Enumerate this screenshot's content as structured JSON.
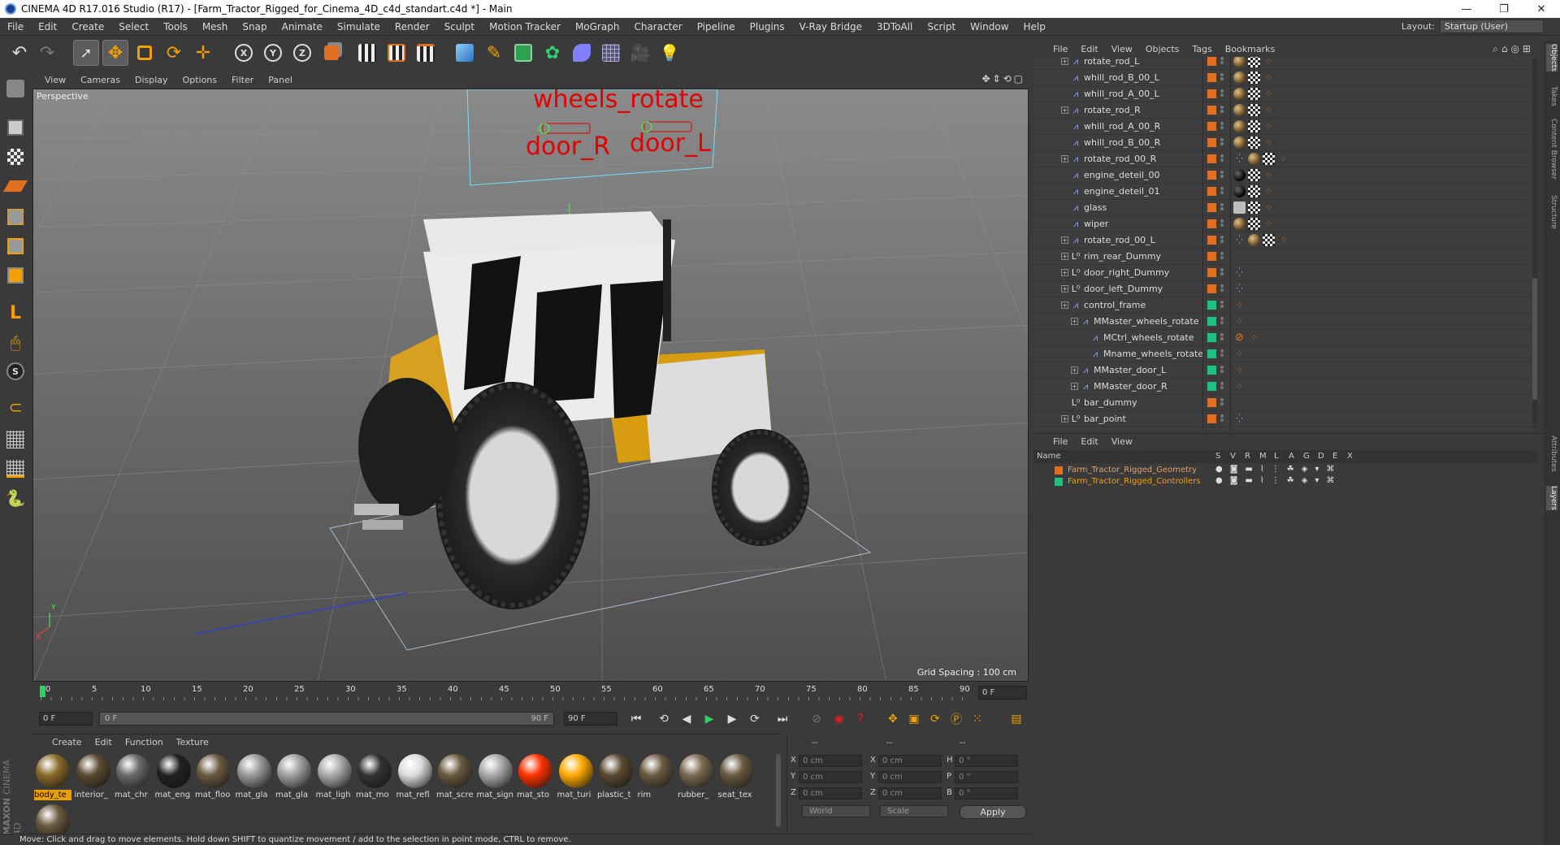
{
  "window": {
    "title": "CINEMA 4D R17.016 Studio (R17) - [Farm_Tractor_Rigged_for_Cinema_4D_c4d_standart.c4d *] - Main",
    "controls": [
      "—",
      "❐",
      "✕"
    ]
  },
  "menubar": {
    "items": [
      "File",
      "Edit",
      "Create",
      "Select",
      "Tools",
      "Mesh",
      "Snap",
      "Animate",
      "Simulate",
      "Render",
      "Sculpt",
      "Motion Tracker",
      "MoGraph",
      "Character",
      "Pipeline",
      "Plugins",
      "V-Ray Bridge",
      "3DToAll",
      "Script",
      "Window",
      "Help"
    ],
    "layout_label": "Layout:",
    "layout_value": "Startup (User)"
  },
  "toolbar": {
    "axis_x": "X",
    "axis_y": "Y",
    "axis_z": "Z"
  },
  "viewport": {
    "menu": [
      "View",
      "Cameras",
      "Display",
      "Options",
      "Filter",
      "Panel"
    ],
    "label": "Perspective",
    "grid_spacing": "Grid Spacing : 100 cm",
    "scene_text": {
      "wheels_rotate": "wheels_rotate",
      "door_R": "door_R",
      "door_L": "door_L"
    },
    "axis_y": "Y",
    "axis_x": "X"
  },
  "timeline": {
    "ticks": [
      "0",
      "5",
      "10",
      "15",
      "20",
      "25",
      "30",
      "35",
      "40",
      "45",
      "50",
      "55",
      "60",
      "65",
      "70",
      "75",
      "80",
      "85",
      "90"
    ],
    "current_frame": "0 F",
    "start_field": "0 F",
    "range_start": "0 F",
    "range_end": "90 F",
    "end_field": "90 F"
  },
  "material_manager": {
    "menu": [
      "Create",
      "Edit",
      "Function",
      "Texture"
    ],
    "materials": [
      {
        "name": "body_te",
        "color": "#8a6a2a"
      },
      {
        "name": "interior_",
        "color": "#5a4a30"
      },
      {
        "name": "mat_chr",
        "color": "#6a6a6a"
      },
      {
        "name": "mat_eng",
        "color": "#222222"
      },
      {
        "name": "mat_floo",
        "color": "#6a5a40"
      },
      {
        "name": "mat_gla",
        "color": "#999999"
      },
      {
        "name": "mat_gla",
        "color": "#a0a0a0"
      },
      {
        "name": "mat_ligh",
        "color": "#aaaaaa"
      },
      {
        "name": "mat_mo",
        "color": "#333333"
      },
      {
        "name": "mat_refl",
        "color": "#dddddd"
      },
      {
        "name": "mat_scre",
        "color": "#6a5a40"
      },
      {
        "name": "mat_sign",
        "color": "#aaaaaa"
      },
      {
        "name": "mat_sto",
        "color": "#ff3300"
      },
      {
        "name": "mat_turi",
        "color": "#ffaa00"
      },
      {
        "name": "plastic_t",
        "color": "#5a4a30"
      },
      {
        "name": "rim",
        "color": "#6a5a40"
      },
      {
        "name": "rubber_",
        "color": "#7a6a50"
      },
      {
        "name": "seat_tex",
        "color": "#6a5a40"
      },
      {
        "name": "",
        "color": "#6a5a40"
      }
    ]
  },
  "coordinates": {
    "headers": [
      "--",
      "--",
      "--"
    ],
    "rows": [
      {
        "l1": "X",
        "v1": "0 cm",
        "l2": "X",
        "v2": "0 cm",
        "l3": "H",
        "v3": "0 °"
      },
      {
        "l1": "Y",
        "v1": "0 cm",
        "l2": "Y",
        "v2": "0 cm",
        "l3": "P",
        "v3": "0 °"
      },
      {
        "l1": "Z",
        "v1": "0 cm",
        "l2": "Z",
        "v2": "0 cm",
        "l3": "B",
        "v3": "0 °"
      }
    ],
    "space": "World",
    "mode": "Scale",
    "apply": "Apply"
  },
  "status": "Move: Click and drag to move elements. Hold down SHIFT to quantize movement / add to the selection in point mode, CTRL to remove.",
  "object_manager": {
    "menu": [
      "File",
      "Edit",
      "View",
      "Objects",
      "Tags",
      "Bookmarks"
    ],
    "rows": [
      {
        "name": "rotate_rod_L",
        "indent": 0,
        "icon": "bone",
        "exp": true,
        "layer": "#e07020",
        "tags": [
          "sph",
          "chk",
          "bone"
        ]
      },
      {
        "name": "whill_rod_B_00_L",
        "indent": 0,
        "icon": "bone",
        "exp": false,
        "layer": "#e07020",
        "tags": [
          "sph",
          "chk",
          "bone"
        ]
      },
      {
        "name": "whill_rod_A_00_L",
        "indent": 0,
        "icon": "bone",
        "exp": false,
        "layer": "#e07020",
        "tags": [
          "sph",
          "chk",
          "bone"
        ]
      },
      {
        "name": "rotate_rod_R",
        "indent": 0,
        "icon": "bone",
        "exp": true,
        "layer": "#e07020",
        "tags": [
          "sph",
          "chk",
          "bone"
        ]
      },
      {
        "name": "whill_rod_A_00_R",
        "indent": 0,
        "icon": "bone",
        "exp": false,
        "layer": "#e07020",
        "tags": [
          "sph",
          "chk",
          "bone"
        ]
      },
      {
        "name": "whill_rod_B_00_R",
        "indent": 0,
        "icon": "bone",
        "exp": false,
        "layer": "#e07020",
        "tags": [
          "sph",
          "chk",
          "bone"
        ]
      },
      {
        "name": "rotate_rod_00_R",
        "indent": 0,
        "icon": "bone",
        "exp": true,
        "layer": "#e07020",
        "tags": [
          "xp",
          "sph",
          "chk",
          "bone"
        ]
      },
      {
        "name": "engine_deteil_00",
        "indent": 0,
        "icon": "bone",
        "exp": false,
        "layer": "#e07020",
        "tags": [
          "blk",
          "chk",
          "bone"
        ]
      },
      {
        "name": "engine_deteil_01",
        "indent": 0,
        "icon": "bone",
        "exp": false,
        "layer": "#e07020",
        "tags": [
          "blk",
          "chk",
          "bone"
        ]
      },
      {
        "name": "glass",
        "indent": 0,
        "icon": "bone",
        "exp": false,
        "layer": "#e07020",
        "tags": [
          "wht",
          "chk",
          "bone"
        ]
      },
      {
        "name": "wiper",
        "indent": 0,
        "icon": "bone",
        "exp": false,
        "layer": "#e07020",
        "tags": [
          "sph",
          "chk",
          "bone"
        ]
      },
      {
        "name": "rotate_rod_00_L",
        "indent": 0,
        "icon": "bone",
        "exp": true,
        "layer": "#e07020",
        "tags": [
          "xp",
          "sph",
          "chk",
          "bone"
        ]
      },
      {
        "name": "rim_rear_Dummy",
        "indent": 0,
        "icon": "null",
        "exp": true,
        "layer": "#e07020",
        "tags": []
      },
      {
        "name": "door_right_Dummy",
        "indent": 0,
        "icon": "null",
        "exp": true,
        "layer": "#e07020",
        "tags": [
          "xp"
        ]
      },
      {
        "name": "door_left_Dummy",
        "indent": 0,
        "icon": "null",
        "exp": true,
        "layer": "#e07020",
        "tags": [
          "xp"
        ]
      },
      {
        "name": "control_frame",
        "indent": 0,
        "icon": "bone",
        "exp": true,
        "layer": "#1fc080",
        "tags": [
          "bone"
        ]
      },
      {
        "name": "MMaster_wheels_rotate",
        "indent": 1,
        "icon": "bone",
        "exp": true,
        "layer": "#1fc080",
        "tags": [
          "bone"
        ]
      },
      {
        "name": "MCtrl_wheels_rotate",
        "indent": 2,
        "icon": "bone",
        "exp": false,
        "layer": "#1fc080",
        "tags": [
          "nope",
          "bone"
        ]
      },
      {
        "name": "Mname_wheels_rotate",
        "indent": 2,
        "icon": "bone",
        "exp": false,
        "layer": "#1fc080",
        "tags": [
          "bone"
        ]
      },
      {
        "name": "MMaster_door_L",
        "indent": 1,
        "icon": "bone",
        "exp": true,
        "layer": "#1fc080",
        "tags": [
          "bone"
        ]
      },
      {
        "name": "MMaster_door_R",
        "indent": 1,
        "icon": "bone",
        "exp": true,
        "layer": "#1fc080",
        "tags": [
          "bone"
        ]
      },
      {
        "name": "bar_dummy",
        "indent": 0,
        "icon": "null",
        "exp": false,
        "layer": "#e07020",
        "tags": []
      },
      {
        "name": "bar_point",
        "indent": 0,
        "icon": "null",
        "exp": true,
        "layer": "#e07020",
        "tags": [
          "xp"
        ]
      }
    ]
  },
  "layer_manager": {
    "menu": [
      "File",
      "Edit",
      "View"
    ],
    "columns": [
      "Name",
      "S",
      "V",
      "R",
      "M",
      "L",
      "A",
      "G",
      "D",
      "E",
      "X"
    ],
    "rows": [
      {
        "name": "Farm_Tractor_Rigged_Geometry",
        "color": "#e07020",
        "text_color": "#e0a070"
      },
      {
        "name": "Farm_Tractor_Rigged_Controllers",
        "color": "#1fc080",
        "text_color": "#f0a000"
      }
    ]
  },
  "right_tabs": [
    "Objects",
    "Takes",
    "Content Browser",
    "Structure",
    "Attributes",
    "Layers"
  ],
  "brand": {
    "line1": "MAXON",
    "line2": "CINEMA 4D"
  }
}
